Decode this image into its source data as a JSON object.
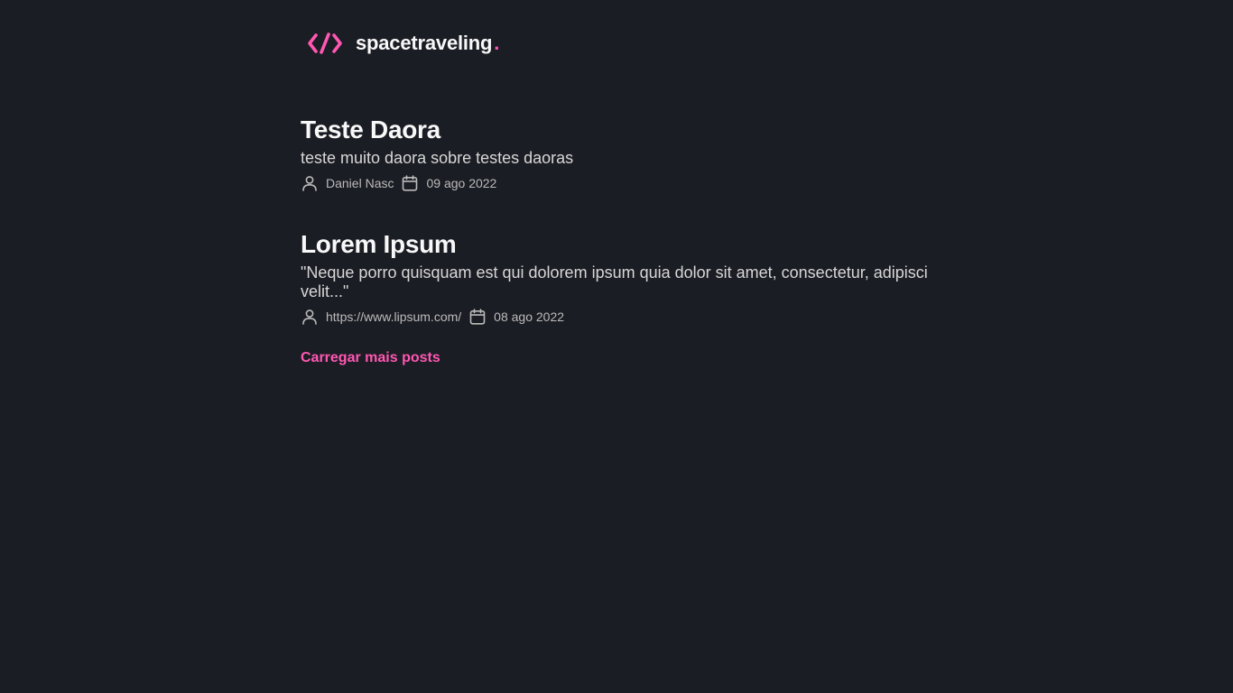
{
  "header": {
    "logo_icon": "code-brackets-icon",
    "brand_name": "spacetraveling",
    "brand_dot": ".",
    "accent_color": "#ff57b2"
  },
  "posts": [
    {
      "title": "Teste Daora",
      "subtitle": "teste muito daora sobre testes daoras",
      "author": "Daniel Nasc",
      "date": "09 ago 2022"
    },
    {
      "title": "Lorem Ipsum",
      "subtitle": "\"Neque porro quisquam est qui dolorem ipsum quia dolor sit amet, consectetur, adipisci velit...\"",
      "author": "https://www.lipsum.com/",
      "date": "08 ago 2022"
    }
  ],
  "icons": {
    "author": "user-icon",
    "date": "calendar-icon"
  },
  "load_more_label": "Carregar mais posts",
  "colors": {
    "background": "#1b1d24",
    "heading": "#f8f8f8",
    "body": "#d7d7d7",
    "info": "#bbbbbb",
    "accent": "#ff57b2"
  }
}
